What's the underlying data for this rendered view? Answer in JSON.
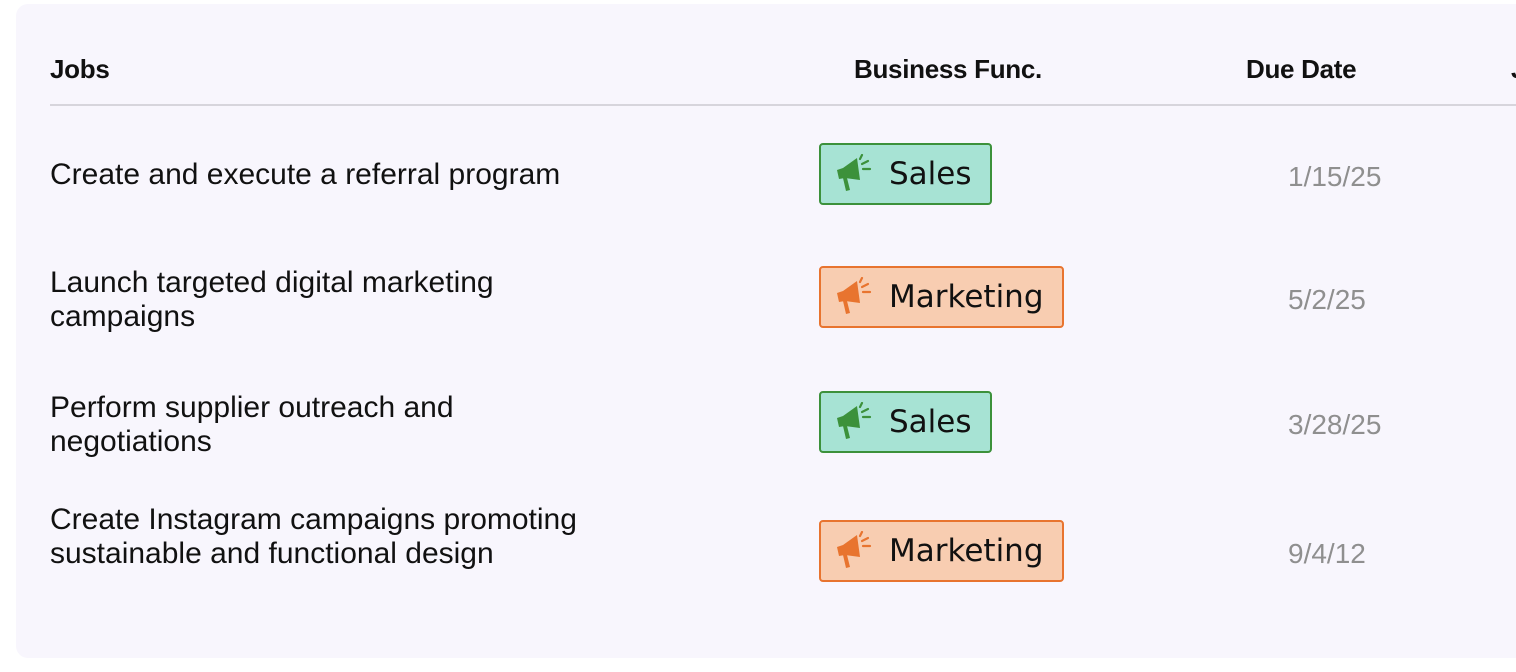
{
  "table": {
    "headers": {
      "jobs": "Jobs",
      "business_func": "Business Func.",
      "due_date": "Due Date",
      "partial_next": "J"
    },
    "rows": [
      {
        "job": "Create and execute a referral program",
        "business_func": "Sales",
        "due_date": "1/15/25"
      },
      {
        "job": "Launch targeted digital marketing campaigns",
        "business_func": "Marketing",
        "due_date": "5/2/25"
      },
      {
        "job": "Perform supplier outreach and negotiations",
        "business_func": "Sales",
        "due_date": "3/28/25"
      },
      {
        "job": "Create Instagram campaigns promoting sustainable and functional design",
        "business_func": "Marketing",
        "due_date": "9/4/12"
      }
    ]
  },
  "badge_styles": {
    "Sales": {
      "background": "#a7e3d4",
      "border": "#3c913b",
      "icon": "megaphone-icon",
      "icon_color": "#3c913b"
    },
    "Marketing": {
      "background": "#f8cdb1",
      "border": "#e8742f",
      "icon": "megaphone-icon",
      "icon_color": "#e8742f"
    }
  },
  "colors": {
    "card_background": "#f8f6fd",
    "header_divider": "#d7d5dc",
    "due_date_text": "#8f8f8f"
  }
}
